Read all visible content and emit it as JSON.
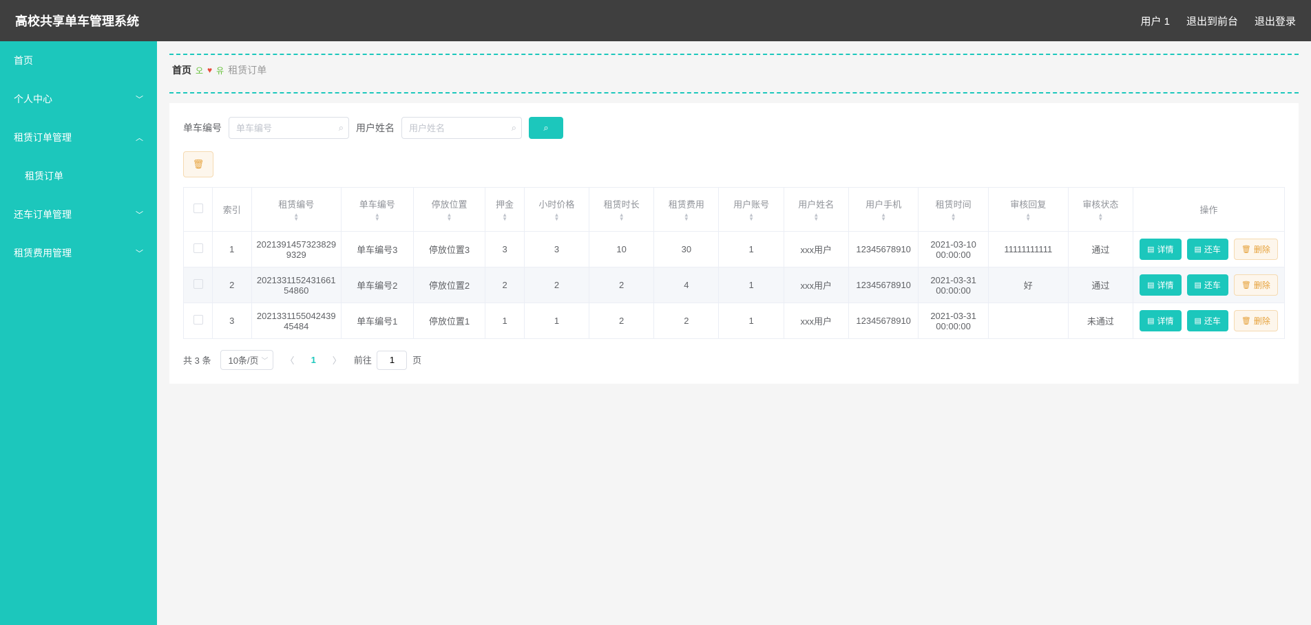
{
  "header": {
    "title": "高校共享单车管理系统",
    "user": "用户 1",
    "to_front": "退出到前台",
    "logout": "退出登录"
  },
  "sidebar": {
    "items": [
      {
        "label": "首页",
        "expandable": false
      },
      {
        "label": "个人中心",
        "expandable": true,
        "open": false
      },
      {
        "label": "租赁订单管理",
        "expandable": true,
        "open": true
      },
      {
        "label": "租赁订单",
        "sub": true
      },
      {
        "label": "还车订单管理",
        "expandable": true,
        "open": false
      },
      {
        "label": "租赁费用管理",
        "expandable": true,
        "open": false
      }
    ]
  },
  "breadcrumb": {
    "home": "首页",
    "sep_left": "오",
    "sep_right": "유",
    "current": "租赁订单"
  },
  "search": {
    "label1": "单车编号",
    "placeholder1": "单车编号",
    "label2": "用户姓名",
    "placeholder2": "用户姓名"
  },
  "table": {
    "columns": [
      "",
      "索引",
      "租赁编号",
      "单车编号",
      "停放位置",
      "押金",
      "小时价格",
      "租赁时长",
      "租赁费用",
      "用户账号",
      "用户姓名",
      "用户手机",
      "租赁时间",
      "审核回复",
      "审核状态",
      "操作"
    ],
    "rows": [
      {
        "idx": "1",
        "rent_no": "2021391457323829932​9",
        "bike_no": "单车编号3",
        "loc": "停放位置3",
        "deposit": "3",
        "price": "3",
        "duration": "10",
        "fee": "30",
        "account": "1",
        "name": "xxx用户",
        "phone": "12345678910",
        "time": "2021-03-10 00:00:00",
        "reply": "11111111111",
        "status": "通过"
      },
      {
        "idx": "2",
        "rent_no": "2021331152431661548​60",
        "bike_no": "单车编号2",
        "loc": "停放位置2",
        "deposit": "2",
        "price": "2",
        "duration": "2",
        "fee": "4",
        "account": "1",
        "name": "xxx用户",
        "phone": "12345678910",
        "time": "2021-03-31 00:00:00",
        "reply": "好",
        "status": "通过"
      },
      {
        "idx": "3",
        "rent_no": "2021331155042439454​84",
        "bike_no": "单车编号1",
        "loc": "停放位置1",
        "deposit": "1",
        "price": "1",
        "duration": "2",
        "fee": "2",
        "account": "1",
        "name": "xxx用户",
        "phone": "12345678910",
        "time": "2021-03-31 00:00:00",
        "reply": "",
        "status": "未通过"
      }
    ],
    "actions": {
      "detail": "详情",
      "return_bike": "还车",
      "delete": "删除"
    }
  },
  "pagination": {
    "total": "共 3 条",
    "per_page": "10条/页",
    "current_page": "1",
    "jump_prefix": "前往",
    "jump_suffix": "页",
    "jump_value": "1"
  }
}
